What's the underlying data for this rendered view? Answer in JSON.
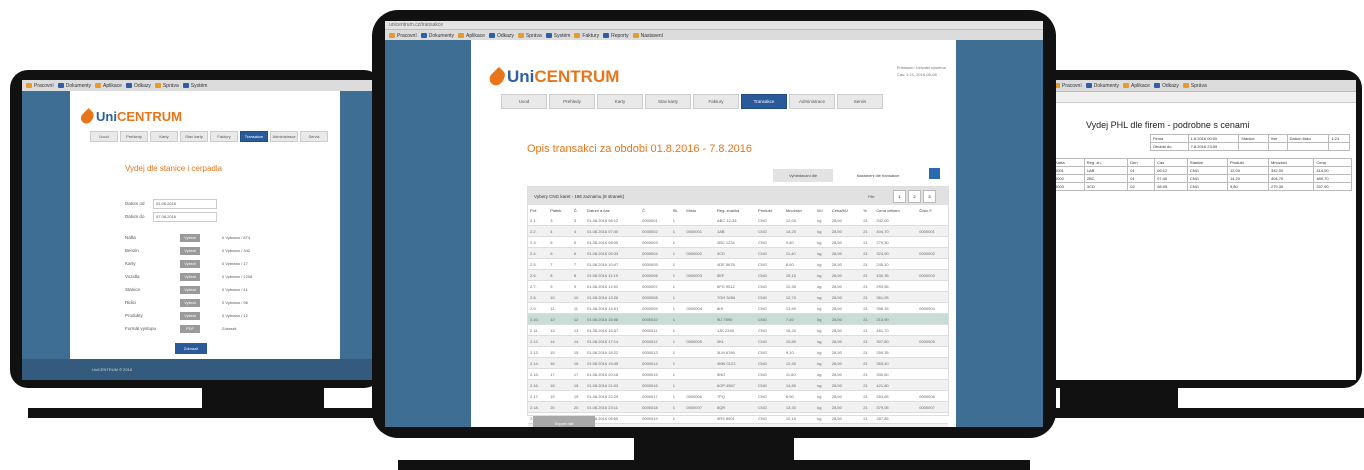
{
  "app": {
    "logo_uni": "Uni",
    "logo_centrum": "CENTRUM"
  },
  "left": {
    "nav": [
      "Uvod",
      "Prehledy",
      "Karty",
      "Stav karty",
      "Faktury",
      "Transakce",
      "Administrace",
      "Servis"
    ],
    "active_nav": 5,
    "title": "Vydej dle stanice i cerpadla",
    "fields": [
      {
        "label": "Datum od",
        "value": "01.08.2016"
      },
      {
        "label": "Datum do",
        "value": "07.08.2016"
      }
    ],
    "rows": [
      {
        "label": "Nafta",
        "btn": "Vybrat",
        "note": "0 Vybrano / 874"
      },
      {
        "label": "Benzin",
        "btn": "Vybrat",
        "note": "0 Vybrano / 342"
      },
      {
        "label": "Karty",
        "btn": "Vybrat",
        "note": "0 Vybrano / 17"
      },
      {
        "label": "Vozidla",
        "btn": "Vybrat",
        "note": "0 Vybrano / 1208"
      },
      {
        "label": "Stanice",
        "btn": "Vybrat",
        "note": "0 Vybrano / 41"
      },
      {
        "label": "Ridici",
        "btn": "Vybrat",
        "note": "0 Vybrano / 96"
      },
      {
        "label": "Produkty",
        "btn": "Vybrat",
        "note": "0 Vybrano / 12"
      },
      {
        "label": "Formát vystupu",
        "btn": "PDF",
        "note": "Zobrazit"
      }
    ],
    "submit": "Zobrazit",
    "footer": "UniCENTRUM © 2016"
  },
  "center": {
    "user_line1": "Prihlasen: Uzivatel systemu",
    "user_line2": "Cas: 1:21, 2016-08-08",
    "nav": [
      "Uvod",
      "Prehledy",
      "Karty",
      "Stav karty",
      "Faktury",
      "Transakce",
      "Administrace",
      "Servis"
    ],
    "active_nav": 5,
    "title": "Opis transakci za obdobi 01.8.2016 - 7.8.2016",
    "tab_a": "Vyhledavani dle",
    "tab_b": "Nastaveni dle transakce",
    "panel_title": "Vybery CNG karet - 186 zaznamu (8 stranek)",
    "filter_label": "Filtr",
    "pager": [
      "1",
      "2",
      "3"
    ],
    "columns": [
      "Poř.",
      "Plátek",
      "Č.",
      "Datum a čas",
      "Č.",
      "Sk",
      "Místo",
      "Reg. značka",
      "Produkt",
      "Množství",
      "MJ",
      "Cena/MJ",
      "%",
      "Cena celkem",
      "Číslo F."
    ],
    "rows": [
      [
        "2.1.",
        "3",
        "3",
        "01.08.2016 06:12",
        "0000001",
        "1",
        "",
        "ABC 12-34",
        "CNG",
        "12,00",
        "kg",
        "28,50",
        "21",
        "342,00",
        ""
      ],
      [
        "2.2.",
        "4",
        "4",
        "01.08.2016 07:40",
        "0000002",
        "1",
        "0000001",
        "1AB",
        "CNG",
        "14,20",
        "kg",
        "28,50",
        "21",
        "404,70",
        "0000001"
      ],
      [
        "2.3.",
        "5",
        "5",
        "01.08.2016 08:05",
        "0000003",
        "1",
        "",
        "2BC 1234",
        "CNG",
        "9,80",
        "kg",
        "28,50",
        "21",
        "279,30",
        ""
      ],
      [
        "2.4.",
        "6",
        "6",
        "01.08.2016 09:33",
        "0000004",
        "1",
        "0000002",
        "3CD",
        "CNG",
        "11,40",
        "kg",
        "28,50",
        "21",
        "324,90",
        "0000002"
      ],
      [
        "2.5.",
        "7",
        "7",
        "01.08.2016 10:47",
        "0000005",
        "1",
        "",
        "4DE 5678",
        "CNG",
        "8,60",
        "kg",
        "28,50",
        "21",
        "245,10",
        ""
      ],
      [
        "2.6.",
        "8",
        "8",
        "01.08.2016 11:19",
        "0000006",
        "1",
        "0000003",
        "5EF",
        "CNG",
        "15,10",
        "kg",
        "28,50",
        "21",
        "430,35",
        "0000003"
      ],
      [
        "2.7.",
        "9",
        "9",
        "01.08.2016 12:02",
        "0000007",
        "1",
        "",
        "6FG 9012",
        "CNG",
        "10,30",
        "kg",
        "28,50",
        "21",
        "293,55",
        ""
      ],
      [
        "2.8.",
        "10",
        "10",
        "01.08.2016 13:26",
        "0000008",
        "1",
        "",
        "7GH 3456",
        "CNG",
        "12,70",
        "kg",
        "28,50",
        "21",
        "361,95",
        ""
      ],
      [
        "2.9.",
        "11",
        "11",
        "01.08.2016 14:51",
        "0000009",
        "1",
        "0000004",
        "8HI",
        "CNG",
        "13,90",
        "kg",
        "28,50",
        "21",
        "396,15",
        "0000004"
      ],
      [
        "2.10.",
        "12",
        "12",
        "01.08.2016 15:08",
        "0000010",
        "1",
        "",
        "9IJ 7890",
        "CNG",
        "7,40",
        "kg",
        "28,50",
        "21",
        "210,90",
        ""
      ],
      [
        "2.11.",
        "13",
        "13",
        "01.08.2016 16:37",
        "0000011",
        "1",
        "",
        "1JK 2345",
        "CNG",
        "16,20",
        "kg",
        "28,50",
        "21",
        "461,70",
        ""
      ],
      [
        "2.12.",
        "14",
        "14",
        "01.08.2016 17:14",
        "0000012",
        "1",
        "0000005",
        "2KL",
        "CNG",
        "10,80",
        "kg",
        "28,50",
        "21",
        "307,80",
        "0000005"
      ],
      [
        "2.13.",
        "15",
        "15",
        "01.08.2016 18:22",
        "0000013",
        "1",
        "",
        "3LM 6789",
        "CNG",
        "9,10",
        "kg",
        "28,50",
        "21",
        "259,35",
        ""
      ],
      [
        "2.14.",
        "16",
        "16",
        "01.08.2016 19:45",
        "0000014",
        "1",
        "",
        "4MN 0123",
        "CNG",
        "12,40",
        "kg",
        "28,50",
        "21",
        "353,40",
        ""
      ],
      [
        "2.15.",
        "17",
        "17",
        "01.08.2016 20:18",
        "0000015",
        "1",
        "",
        "5NO",
        "CNG",
        "11,60",
        "kg",
        "28,50",
        "21",
        "330,60",
        ""
      ],
      [
        "2.16.",
        "18",
        "18",
        "01.08.2016 21:03",
        "0000016",
        "1",
        "",
        "6OP 4567",
        "CNG",
        "14,80",
        "kg",
        "28,50",
        "21",
        "421,80",
        ""
      ],
      [
        "2.17.",
        "19",
        "19",
        "01.08.2016 22:29",
        "0000017",
        "1",
        "0000006",
        "7PQ",
        "CNG",
        "8,90",
        "kg",
        "28,50",
        "21",
        "253,65",
        "0000006"
      ],
      [
        "2.18.",
        "20",
        "20",
        "01.08.2016 23:11",
        "0000018",
        "1",
        "0000007",
        "8QR",
        "CNG",
        "13,30",
        "kg",
        "28,50",
        "21",
        "379,05",
        "0000007"
      ],
      [
        "2.19.",
        "21",
        "21",
        "02.08.2016 06:55",
        "0000019",
        "1",
        "",
        "9RS 8901",
        "CNG",
        "10,10",
        "kg",
        "28,50",
        "21",
        "287,85",
        ""
      ],
      [
        "2.20.",
        "22",
        "22",
        "02.08.2016 07:42",
        "0000020",
        "1",
        "",
        "1ST 2345",
        "CNG",
        "12,90",
        "kg",
        "28,50",
        "21",
        "367,65",
        ""
      ]
    ],
    "highlight_row": 9,
    "export_btn": "Export dat"
  },
  "right": {
    "title": "Vydej PHL dle firem - podrobne s cenami",
    "info": [
      [
        "Firma",
        "1.8.2016 00:00",
        "Stanice",
        "Vse",
        "Datum tisku",
        "1:21"
      ],
      [
        "Obdobi do",
        "7.8.2016 23:59",
        "",
        "",
        "",
        ""
      ]
    ],
    "columns": [
      "Karta",
      "Reg. zn.",
      "Den",
      "Cas",
      "Stanice",
      "Produkt",
      "Mnozstvi",
      "Cena"
    ],
    "rows": [
      [
        "0001",
        "1AB",
        "01",
        "06:12",
        "CNG",
        "12,00",
        "342,00",
        "414,00"
      ],
      [
        "0002",
        "2BC",
        "01",
        "07:40",
        "CNG",
        "14,20",
        "404,70",
        "489,70"
      ],
      [
        "0003",
        "3CD",
        "02",
        "08:05",
        "CNG",
        "9,80",
        "279,30",
        "337,90"
      ]
    ]
  }
}
